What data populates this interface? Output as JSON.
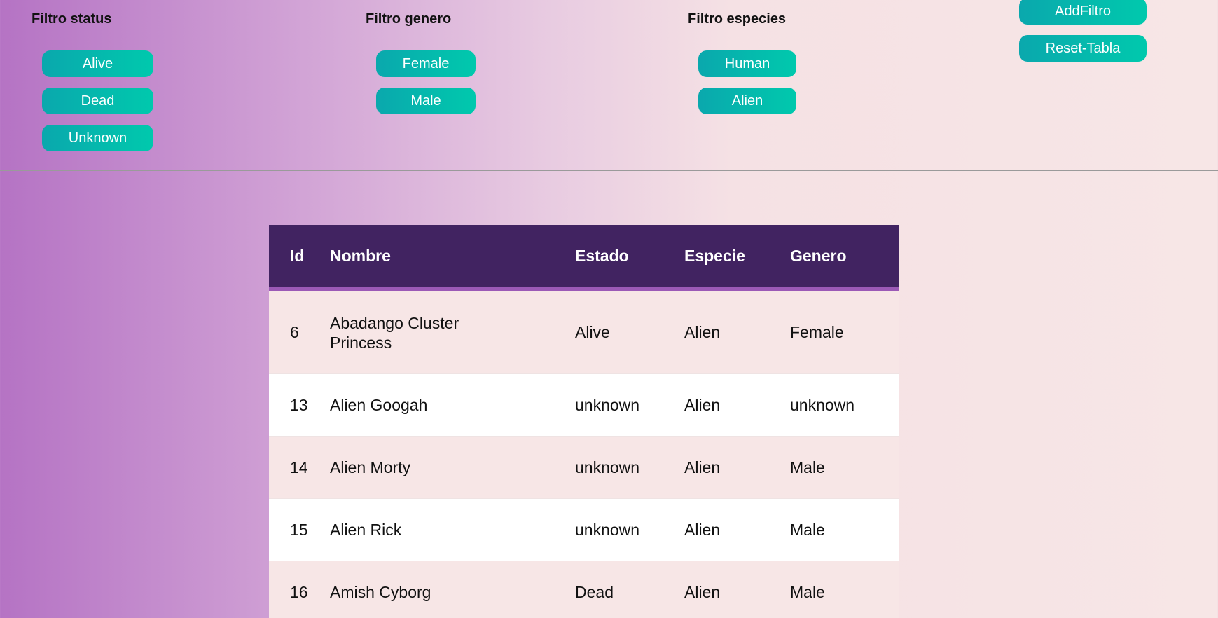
{
  "filters": {
    "status": {
      "title": "Filtro status",
      "options": [
        "Alive",
        "Dead",
        "Unknown"
      ]
    },
    "genero": {
      "title": "Filtro genero",
      "options": [
        "Female",
        "Male"
      ]
    },
    "especies": {
      "title": "Filtro especies",
      "options": [
        "Human",
        "Alien"
      ]
    },
    "actions": {
      "add_label": "AddFiltro",
      "reset_label": "Reset-Tabla"
    }
  },
  "table": {
    "headers": [
      "Id",
      "Nombre",
      "Estado",
      "Especie",
      "Genero"
    ],
    "rows": [
      [
        "6",
        "Abadango Cluster Princess",
        "Alive",
        "Alien",
        "Female"
      ],
      [
        "13",
        "Alien Googah",
        "unknown",
        "Alien",
        "unknown"
      ],
      [
        "14",
        "Alien Morty",
        "unknown",
        "Alien",
        "Male"
      ],
      [
        "15",
        "Alien Rick",
        "unknown",
        "Alien",
        "Male"
      ],
      [
        "16",
        "Amish Cyborg",
        "Dead",
        "Alien",
        "Male"
      ]
    ]
  },
  "colors": {
    "pill_gradient_start": "#0aa8ad",
    "pill_gradient_end": "#00c9ad",
    "table_header": "#412361",
    "table_header_underline": "#9b59b6",
    "row_odd": "#f7e6e6",
    "row_even": "#ffffff",
    "background_left": "#b573c4",
    "background_right": "#f7e6e6"
  }
}
